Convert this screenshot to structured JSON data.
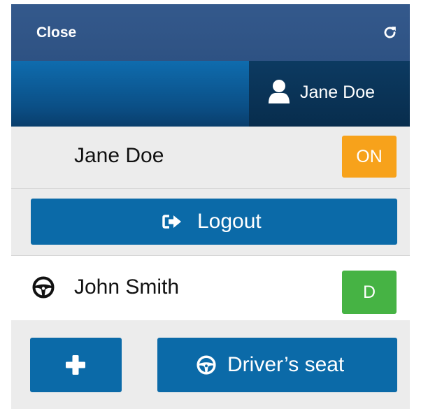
{
  "topbar": {
    "close_label": "Close",
    "refresh_icon": "refresh-icon"
  },
  "userbar": {
    "user_icon": "user-icon",
    "user_name": "Jane Doe"
  },
  "current_user": {
    "name": "Jane Doe",
    "status_badge": "ON",
    "status_color": "#f7a21b"
  },
  "logout_button": {
    "icon": "sign-out-icon",
    "label": "Logout"
  },
  "driver_row": {
    "icon": "steering-wheel-icon",
    "name": "John Smith",
    "badge": "D",
    "badge_color": "#46b344"
  },
  "actions": {
    "add_icon": "plus-icon",
    "seat_icon": "steering-wheel-icon",
    "seat_label": "Driver’s seat"
  },
  "colors": {
    "topbar": "#34598c",
    "userbar": "#0b4f86",
    "user_tab": "#082d4d",
    "button": "#0b6aa8",
    "panel_bg": "#ececec"
  }
}
